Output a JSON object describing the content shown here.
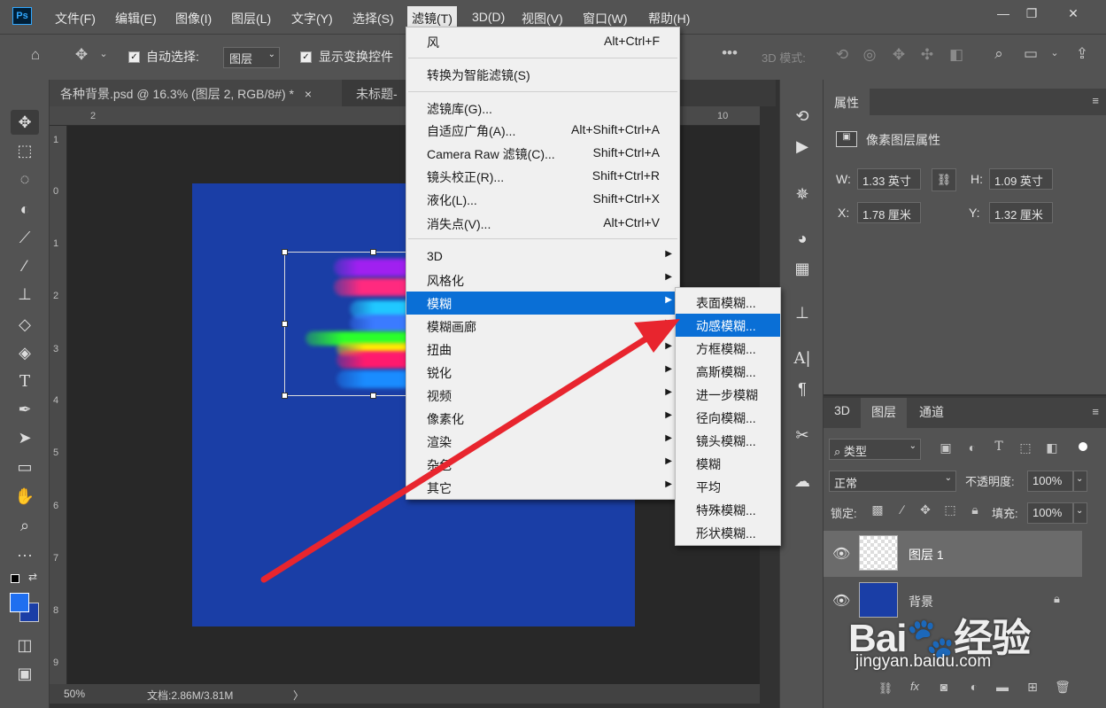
{
  "app": {
    "logo": "Ps"
  },
  "menubar": {
    "items": [
      "文件(F)",
      "编辑(E)",
      "图像(I)",
      "图层(L)",
      "文字(Y)",
      "选择(S)",
      "滤镜(T)",
      "3D(D)",
      "视图(V)",
      "窗口(W)",
      "帮助(H)"
    ],
    "active": "滤镜(T)"
  },
  "options_bar": {
    "auto_select_label": "自动选择:",
    "auto_select_value": "图层",
    "show_transform_label": "显示变换控件",
    "mode_3d_label": "3D 模式:",
    "more": "•••"
  },
  "tabs": [
    {
      "label": "各种背景.psd @ 16.3% (图层 2, RGB/8#) *",
      "close": "×"
    },
    {
      "label": "未标题-"
    }
  ],
  "ruler": {
    "top": [
      "2",
      "10"
    ],
    "left": [
      "1",
      "0",
      "1",
      "2",
      "3",
      "4",
      "5",
      "6",
      "7",
      "8",
      "9"
    ]
  },
  "status": {
    "zoom": "50%",
    "doc": "文档:2.86M/3.81M",
    "arrow": "〉"
  },
  "filter_menu": {
    "items": [
      {
        "label": "风",
        "shortcut": "Alt+Ctrl+F"
      },
      {
        "label": "转换为智能滤镜(S)",
        "shortcut": ""
      },
      {
        "label": "滤镜库(G)...",
        "shortcut": ""
      },
      {
        "label": "自适应广角(A)...",
        "shortcut": "Alt+Shift+Ctrl+A"
      },
      {
        "label": "Camera Raw 滤镜(C)...",
        "shortcut": "Shift+Ctrl+A"
      },
      {
        "label": "镜头校正(R)...",
        "shortcut": "Shift+Ctrl+R"
      },
      {
        "label": "液化(L)...",
        "shortcut": "Shift+Ctrl+X"
      },
      {
        "label": "消失点(V)...",
        "shortcut": "Alt+Ctrl+V"
      },
      {
        "label": "3D",
        "shortcut": ""
      },
      {
        "label": "风格化",
        "shortcut": ""
      },
      {
        "label": "模糊",
        "shortcut": ""
      },
      {
        "label": "模糊画廊",
        "shortcut": ""
      },
      {
        "label": "扭曲",
        "shortcut": ""
      },
      {
        "label": "锐化",
        "shortcut": ""
      },
      {
        "label": "视频",
        "shortcut": ""
      },
      {
        "label": "像素化",
        "shortcut": ""
      },
      {
        "label": "渲染",
        "shortcut": ""
      },
      {
        "label": "杂色",
        "shortcut": ""
      },
      {
        "label": "其它",
        "shortcut": ""
      }
    ],
    "highlighted": "模糊",
    "submenu_arrow": "▶"
  },
  "blur_submenu": {
    "items": [
      "表面模糊...",
      "动感模糊...",
      "方框模糊...",
      "高斯模糊...",
      "进一步模糊",
      "径向模糊...",
      "镜头模糊...",
      "模糊",
      "平均",
      "特殊模糊...",
      "形状模糊..."
    ],
    "highlighted": "动感模糊..."
  },
  "properties": {
    "tab": "属性",
    "title": "像素图层属性",
    "w_label": "W:",
    "w_value": "1.33 英寸",
    "h_label": "H:",
    "h_value": "1.09 英寸",
    "x_label": "X:",
    "x_value": "1.78 厘米",
    "y_label": "Y:",
    "y_value": "1.32 厘米"
  },
  "layers_panel": {
    "tabs": [
      "3D",
      "图层",
      "通道"
    ],
    "active_tab": "图层",
    "filter_label": "类型",
    "blend_mode": "正常",
    "opacity_label": "不透明度:",
    "opacity_value": "100%",
    "lock_label": "锁定:",
    "fill_label": "填充:",
    "fill_value": "100%",
    "layers": [
      {
        "name": "图层 1",
        "selected": true
      },
      {
        "name": "背景",
        "locked": true
      }
    ]
  },
  "watermark": {
    "logo": "Bai🐾经验",
    "url": "jingyan.baidu.com"
  },
  "colors": {
    "accent": "#0a6fd6",
    "doc_blue": "#1a3ea6",
    "arrow_red": "#e8252e",
    "foreground": "#1f6ff0",
    "background": "#1a3ea6"
  },
  "stripes": [
    "#a020f0",
    "#ff2a7f",
    "#20c8ff",
    "#3b7bff",
    "#2bff2b",
    "#ffee00",
    "#ff1a6e",
    "#1a8cff"
  ]
}
